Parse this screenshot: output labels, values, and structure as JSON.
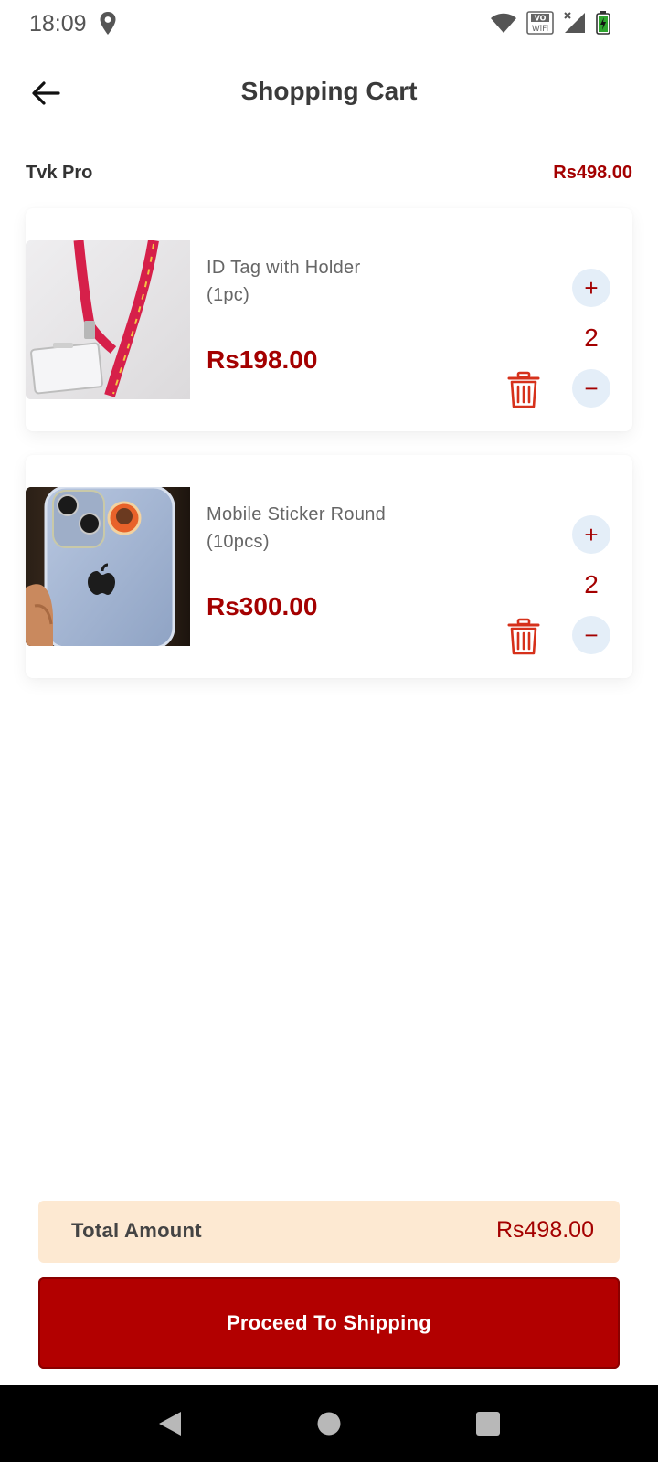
{
  "status_bar": {
    "time": "18:09",
    "icons": [
      "location-icon",
      "wifi-icon",
      "vowifi-icon",
      "signal-icon",
      "battery-icon"
    ]
  },
  "header": {
    "title": "Shopping Cart",
    "back_icon": "arrow-left-icon"
  },
  "store": {
    "name": "Tvk Pro",
    "total": "Rs498.00"
  },
  "cart_items": [
    {
      "name": "ID Tag with Holder (1pc)",
      "price": "Rs198.00",
      "quantity": "2",
      "plus_label": "+",
      "minus_label": "−"
    },
    {
      "name": "Mobile Sticker Round (10pcs)",
      "price": "Rs300.00",
      "quantity": "2",
      "plus_label": "+",
      "minus_label": "−"
    }
  ],
  "summary": {
    "total_label": "Total Amount",
    "total_value": "Rs498.00"
  },
  "actions": {
    "proceed_label": "Proceed To Shipping"
  },
  "colors": {
    "accent": "#a40000",
    "button": "#b20000",
    "total_bg": "#fde9d2",
    "qty_btn_bg": "#e4eef8"
  },
  "nav_bar": {
    "icons": [
      "back-triangle-icon",
      "home-circle-icon",
      "recents-square-icon"
    ]
  }
}
